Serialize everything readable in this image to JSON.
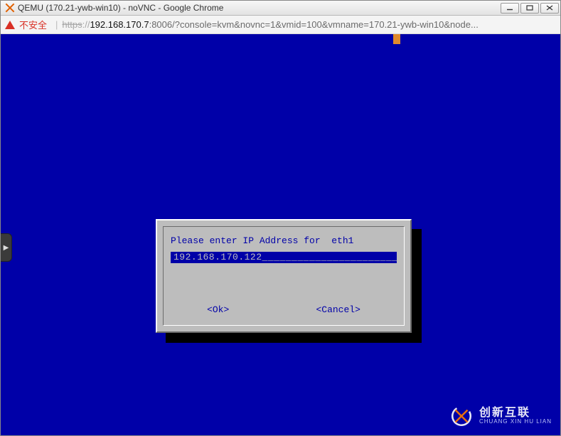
{
  "window": {
    "title": "QEMU (170.21-ywb-win10) - noVNC - Google Chrome"
  },
  "url": {
    "insecure_label": "不安全",
    "protocol_struck": "https",
    "protocol_sep": "://",
    "host": "192.168.170.7",
    "rest": ":8006/?console=kvm&novnc=1&vmid=100&vmname=170.21-ywb-win10&node...",
    "separator": "|"
  },
  "novnc_tab": {
    "glyph": "▶"
  },
  "dialog": {
    "prompt": "Please enter IP Address for  eth1",
    "value": "192.168.170.122",
    "pad": "_______________________",
    "ok_label": "<Ok>",
    "cancel_label": "<Cancel>"
  },
  "watermark": {
    "cn": "创新互联",
    "en": "CHUANG XIN HU LIAN"
  }
}
